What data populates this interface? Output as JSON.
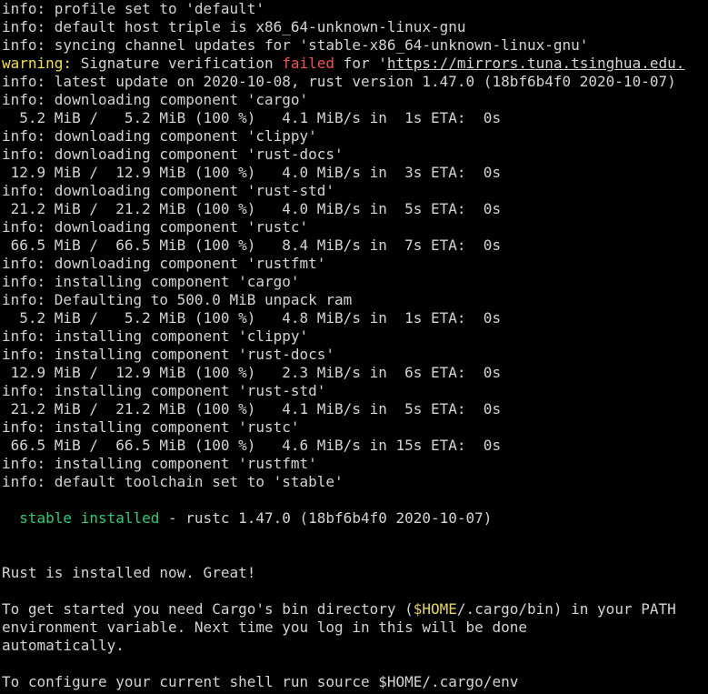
{
  "colors": {
    "background": "#000000",
    "text": "#d3d3d3",
    "warning": "#f0e040",
    "failed": "#ef5350",
    "success": "#2ecc71",
    "variable": "#e5d84a"
  },
  "lines": [
    {
      "type": "plain",
      "text": "info: profile set to 'default'"
    },
    {
      "type": "plain",
      "text": "info: default host triple is x86_64-unknown-linux-gnu"
    },
    {
      "type": "plain",
      "text": "info: syncing channel updates for 'stable-x86_64-unknown-linux-gnu'"
    },
    {
      "type": "warning",
      "label": "warning:",
      "pre": " Signature verification ",
      "failed": "failed",
      "mid": " for '",
      "url": "https://mirrors.tuna.tsinghua.edu."
    },
    {
      "type": "plain",
      "text": "info: latest update on 2020-10-08, rust version 1.47.0 (18bf6b4f0 2020-10-07)"
    },
    {
      "type": "plain",
      "text": "info: downloading component 'cargo'"
    },
    {
      "type": "plain",
      "text": "  5.2 MiB /   5.2 MiB (100 %)   4.1 MiB/s in  1s ETA:  0s"
    },
    {
      "type": "plain",
      "text": "info: downloading component 'clippy'"
    },
    {
      "type": "plain",
      "text": "info: downloading component 'rust-docs'"
    },
    {
      "type": "plain",
      "text": " 12.9 MiB /  12.9 MiB (100 %)   4.0 MiB/s in  3s ETA:  0s"
    },
    {
      "type": "plain",
      "text": "info: downloading component 'rust-std'"
    },
    {
      "type": "plain",
      "text": " 21.2 MiB /  21.2 MiB (100 %)   4.0 MiB/s in  5s ETA:  0s"
    },
    {
      "type": "plain",
      "text": "info: downloading component 'rustc'"
    },
    {
      "type": "plain",
      "text": " 66.5 MiB /  66.5 MiB (100 %)   8.4 MiB/s in  7s ETA:  0s"
    },
    {
      "type": "plain",
      "text": "info: downloading component 'rustfmt'"
    },
    {
      "type": "plain",
      "text": "info: installing component 'cargo'"
    },
    {
      "type": "plain",
      "text": "info: Defaulting to 500.0 MiB unpack ram"
    },
    {
      "type": "plain",
      "text": "  5.2 MiB /   5.2 MiB (100 %)   4.8 MiB/s in  1s ETA:  0s"
    },
    {
      "type": "plain",
      "text": "info: installing component 'clippy'"
    },
    {
      "type": "plain",
      "text": "info: installing component 'rust-docs'"
    },
    {
      "type": "plain",
      "text": " 12.9 MiB /  12.9 MiB (100 %)   2.3 MiB/s in  6s ETA:  0s"
    },
    {
      "type": "plain",
      "text": "info: installing component 'rust-std'"
    },
    {
      "type": "plain",
      "text": " 21.2 MiB /  21.2 MiB (100 %)   4.1 MiB/s in  5s ETA:  0s"
    },
    {
      "type": "plain",
      "text": "info: installing component 'rustc'"
    },
    {
      "type": "plain",
      "text": " 66.5 MiB /  66.5 MiB (100 %)   4.6 MiB/s in 15s ETA:  0s"
    },
    {
      "type": "plain",
      "text": "info: installing component 'rustfmt'"
    },
    {
      "type": "plain",
      "text": "info: default toolchain set to 'stable'"
    },
    {
      "type": "plain",
      "text": ""
    },
    {
      "type": "installed",
      "indent": "  ",
      "green": "stable installed",
      "rest": " - rustc 1.47.0 (18bf6b4f0 2020-10-07)"
    },
    {
      "type": "plain",
      "text": ""
    },
    {
      "type": "plain",
      "text": ""
    },
    {
      "type": "plain",
      "text": "Rust is installed now. Great!"
    },
    {
      "type": "plain",
      "text": ""
    },
    {
      "type": "path",
      "pre": "To get started you need Cargo's bin directory (",
      "var": "$HOME",
      "post": "/.cargo/bin) in your PATH"
    },
    {
      "type": "plain",
      "text": "environment variable. Next time you log in this will be done"
    },
    {
      "type": "plain",
      "text": "automatically."
    },
    {
      "type": "plain",
      "text": ""
    },
    {
      "type": "plain",
      "text": "To configure your current shell run source $HOME/.cargo/env"
    }
  ]
}
